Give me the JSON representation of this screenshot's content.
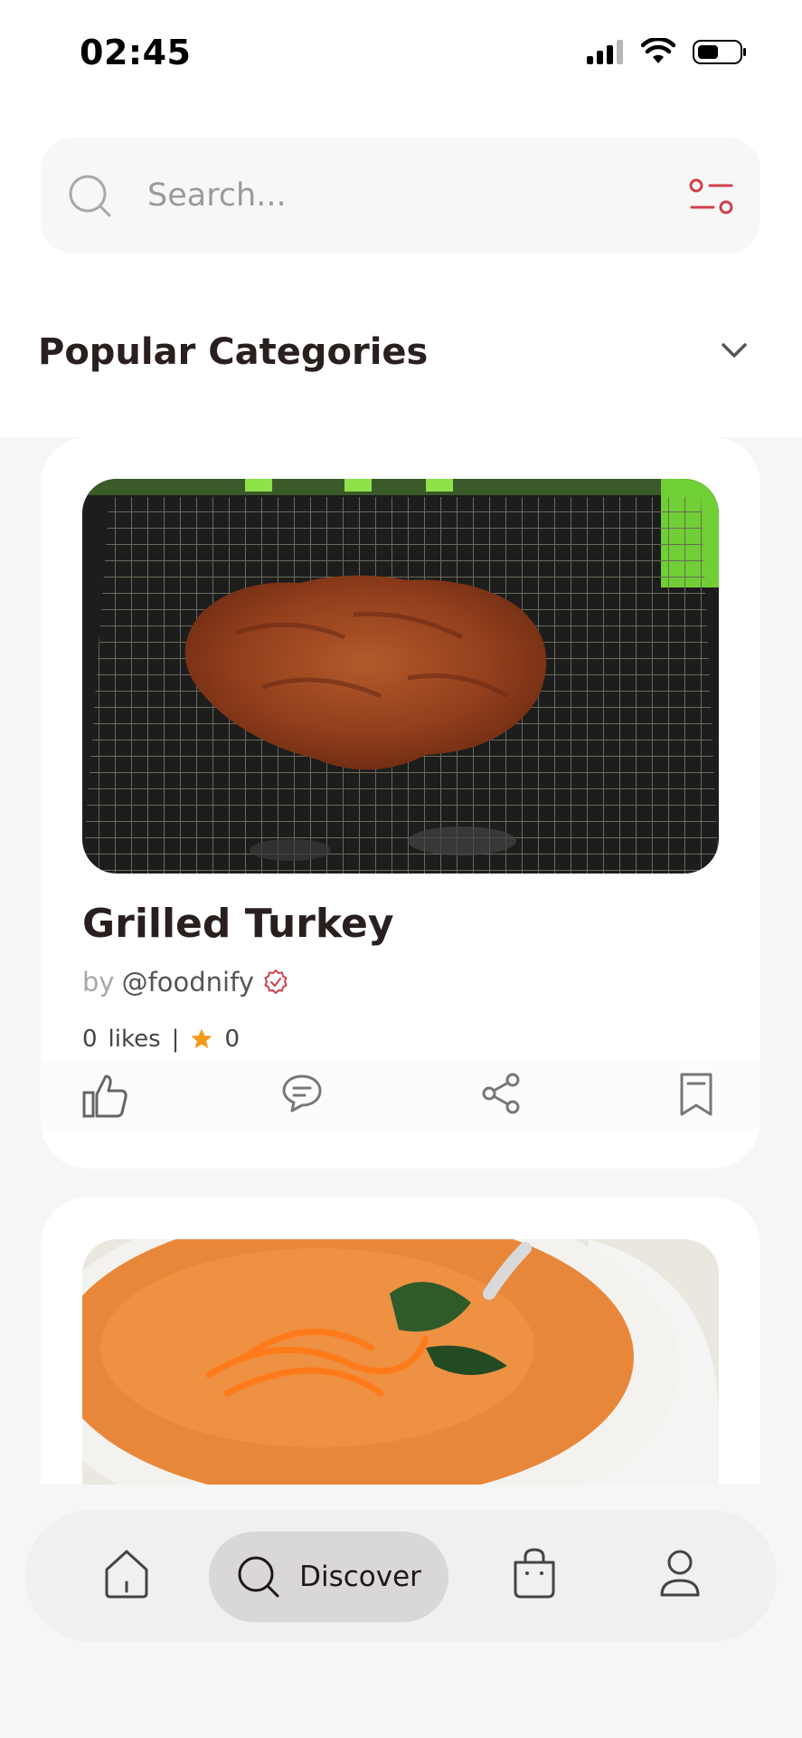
{
  "status_bar": {
    "time": "02:45",
    "icons": [
      "cellular-signal-icon",
      "wifi-icon",
      "battery-icon"
    ]
  },
  "search": {
    "placeholder": "Search...",
    "search_icon": "search-icon",
    "filter_icon": "filter-sliders-icon"
  },
  "section": {
    "title": "Popular Categories",
    "toggle_icon": "chevron-down-icon"
  },
  "recipes": [
    {
      "title": "Grilled Turkey",
      "by_label": "by",
      "author": "@foodnify",
      "verified_icon": "verified-badge-icon",
      "likes_count": "0",
      "likes_label": "likes",
      "separator": "|",
      "rating": "0",
      "rating_icon": "star-icon",
      "image": "grilled-turkey-photo",
      "actions": [
        "like-icon",
        "comment-icon",
        "share-icon",
        "bookmark-icon"
      ]
    },
    {
      "image": "carrot-soup-photo"
    }
  ],
  "bottom_nav": {
    "items": [
      {
        "icon": "home-icon"
      },
      {
        "icon": "search-icon",
        "label": "Discover",
        "active": true
      },
      {
        "icon": "shopping-bag-icon"
      },
      {
        "icon": "profile-icon"
      }
    ]
  },
  "colors": {
    "accent": "#d0404a",
    "star": "#f39a1a",
    "text": "#2a1f1f",
    "nav_active_bg": "#d9d7d7"
  }
}
